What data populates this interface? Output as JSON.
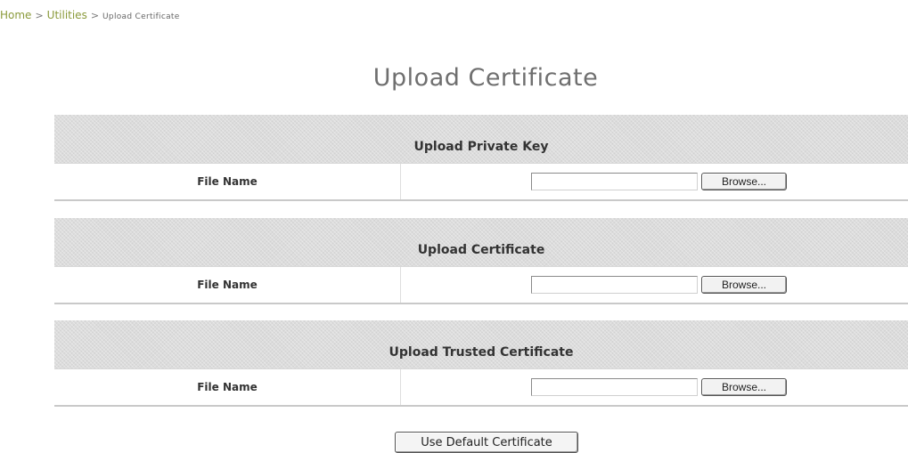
{
  "breadcrumb": {
    "home": "Home",
    "sep1": ">",
    "utilities": "Utilities",
    "sep2": ">",
    "current": "Upload Certificate"
  },
  "page_title": "Upload Certificate",
  "sections": [
    {
      "header": "Upload Private Key",
      "row_label": "File Name",
      "input_value": "",
      "browse_label": "Browse..."
    },
    {
      "header": "Upload Certificate",
      "row_label": "File Name",
      "input_value": "",
      "browse_label": "Browse..."
    },
    {
      "header": "Upload Trusted Certificate",
      "row_label": "File Name",
      "input_value": "",
      "browse_label": "Browse..."
    }
  ],
  "default_button_label": "Use Default Certificate",
  "colors": {
    "breadcrumb_link": "#8a9a3a",
    "title": "#6f6f6f",
    "header_bg": "#dcdcdc"
  }
}
